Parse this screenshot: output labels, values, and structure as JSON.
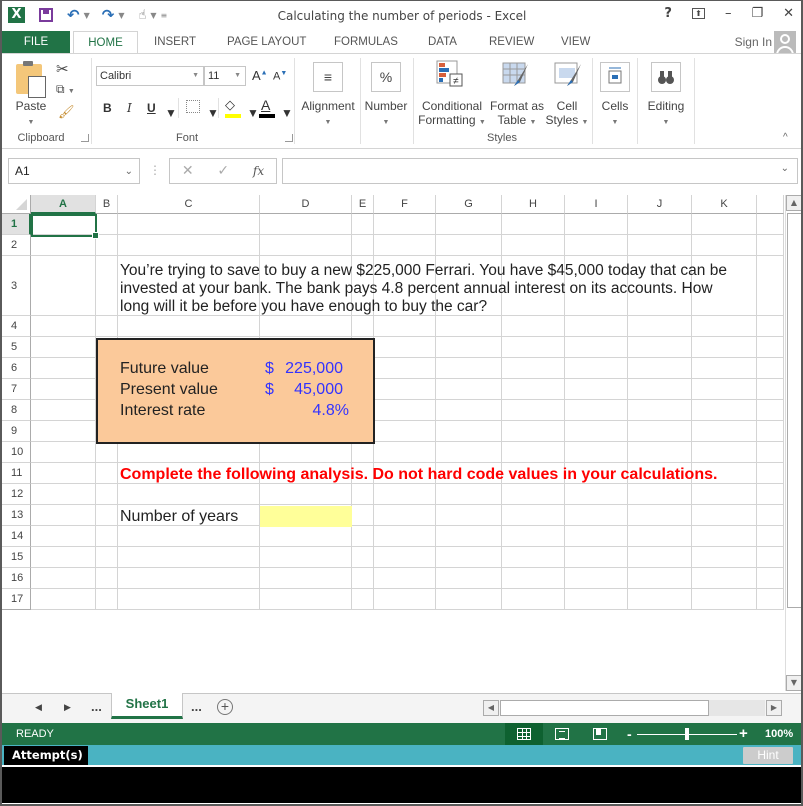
{
  "window": {
    "title": "Calculating the number of periods - Excel",
    "controls": [
      "help-icon",
      "ribbon-display-icon",
      "minimize-icon",
      "restore-icon",
      "close-icon"
    ]
  },
  "ribbon_tabs": {
    "file": "FILE",
    "home": "HOME",
    "insert": "INSERT",
    "page_layout": "PAGE LAYOUT",
    "formulas": "FORMULAS",
    "data": "DATA",
    "review": "REVIEW",
    "view": "VIEW",
    "sign_in": "Sign In"
  },
  "ribbon": {
    "clipboard": {
      "paste": "Paste",
      "label": "Clipboard"
    },
    "font": {
      "name": "Calibri",
      "size": "11",
      "bold": "B",
      "italic": "I",
      "underline": "U",
      "grow": "A",
      "shrink": "A",
      "font_color": "A",
      "label": "Font",
      "highlight_color": "#ffff00",
      "text_color": "#000000"
    },
    "alignment": "Alignment",
    "number": "Number",
    "number_icon": "%",
    "styles": {
      "conditional_line1": "Conditional",
      "conditional_line2": "Formatting",
      "table_line1": "Format as",
      "table_line2": "Table",
      "cell_line1": "Cell",
      "cell_line2": "Styles",
      "label": "Styles"
    },
    "cells": "Cells",
    "editing": "Editing"
  },
  "formula_bar": {
    "name_box": "A1",
    "cancel": "✕",
    "enter": "✓",
    "fx": "fx",
    "value": ""
  },
  "grid": {
    "columns": [
      "A",
      "B",
      "C",
      "D",
      "E",
      "F",
      "G",
      "H",
      "I",
      "J",
      "K"
    ],
    "rows": [
      "1",
      "2",
      "3",
      "4",
      "5",
      "6",
      "7",
      "8",
      "9",
      "10",
      "11",
      "12",
      "13",
      "14",
      "15",
      "16",
      "17"
    ],
    "selected_cell": "A1",
    "problem_lines": [
      "You’re trying to save to buy a new $225,000 Ferrari. You have $45,000 today that can be",
      "invested at your bank. The bank pays 4.8 percent annual interest on its accounts. How",
      "long will it be before you have enough to buy the car?"
    ],
    "inputs": [
      {
        "label": "Future value",
        "currency": "$",
        "value": "225,000"
      },
      {
        "label": "Present value",
        "currency": "$",
        "value": "45,000"
      },
      {
        "label": "Interest rate",
        "currency": "",
        "value": "4.8%"
      }
    ],
    "instruction": "Complete the following analysis. Do not hard code values in your calculations.",
    "output_label": "Number of years",
    "output_value": "",
    "colors": {
      "input_box_fill": "#fbc99a",
      "input_value_color": "#3333ff",
      "instruction_color": "#ff0000",
      "output_fill": "#ffff99"
    }
  },
  "sheets": {
    "nav_prev": "◀",
    "nav_next": "▶",
    "ellipsis_left": "...",
    "active": "Sheet1",
    "ellipsis_right": "...",
    "add": "+"
  },
  "status": {
    "mode": "READY",
    "zoom": "100%",
    "zoom_level": 100
  },
  "attempt": {
    "label": "Attempt(s)",
    "hint": "Hint"
  }
}
